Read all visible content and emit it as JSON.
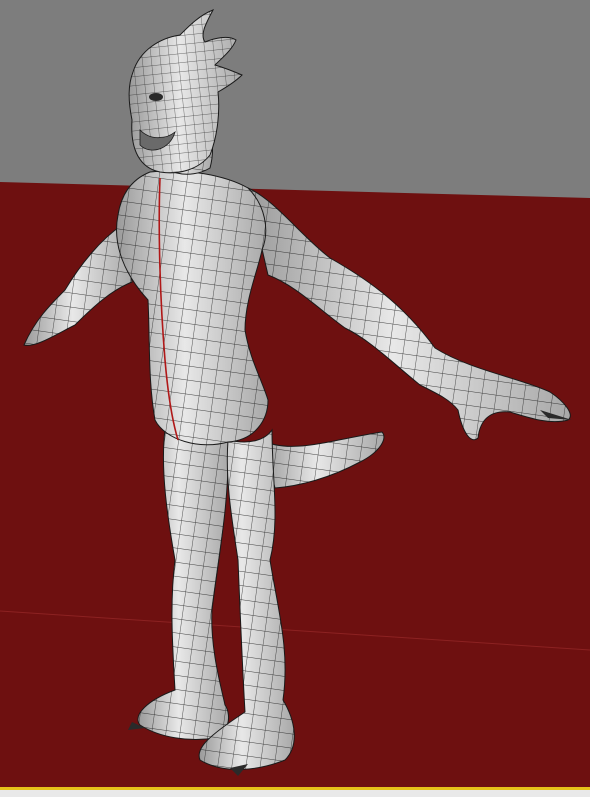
{
  "viewport": {
    "background_color": "#7d7d7d",
    "floor_color": "#6e1010",
    "highlight_border_color": "#e6c21a"
  },
  "model": {
    "surface_color": "#d9d9d9",
    "wire_color": "#1a1a1a",
    "seam_color": "#b01818"
  }
}
